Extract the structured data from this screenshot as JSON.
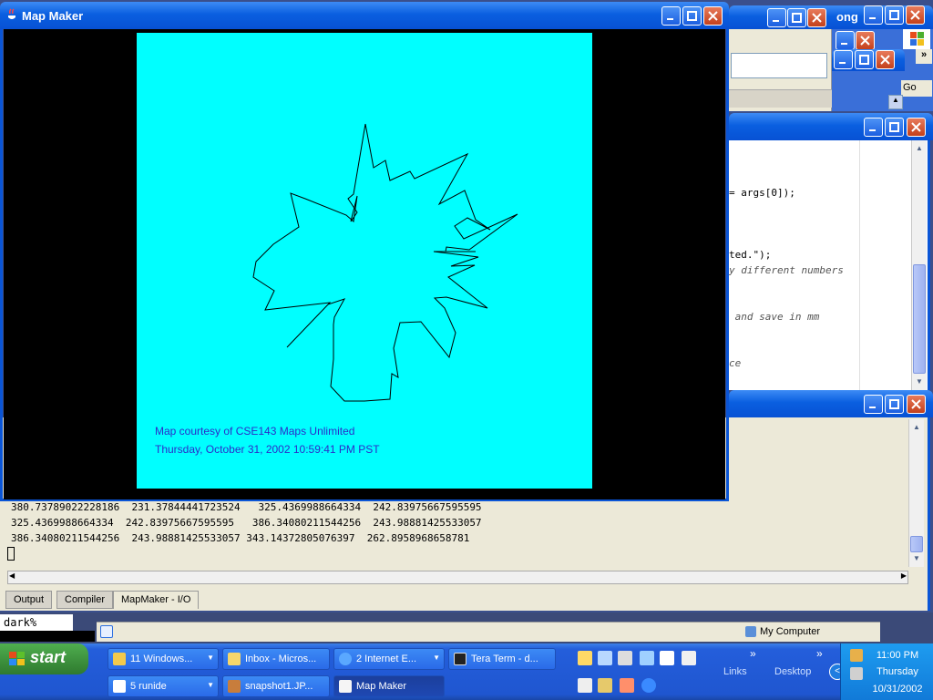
{
  "mapmaker": {
    "title": "Map Maker",
    "credit": "Map courtesy of CSE143 Maps Unlimited",
    "timestamp": "Thursday, October 31, 2002 10:59:41 PM PST",
    "map_bg": "#00ffff"
  },
  "background_windows": {
    "partial_title": "ong",
    "addr_go": "Go",
    "code_lines": [
      {
        "text": "= args[0]);",
        "style": "code"
      },
      {
        "text": "ted.\");",
        "style": "code"
      },
      {
        "text": "y different numbers",
        "style": "comment"
      },
      {
        "text": " and save in mm",
        "style": "comment"
      },
      {
        "text": "ce",
        "style": "comment"
      }
    ]
  },
  "output": {
    "lines": [
      "380.73789022228186  231.37844441723524   325.4369988664334  242.83975667595595",
      "325.4369988664334  242.83975667595595   386.34080211544256  243.98881425533057",
      "386.34080211544256  243.98881425533057 343.14372805076397  262.8958968658781"
    ],
    "tabs": [
      "Output",
      "Compiler",
      "MapMaker - I/O"
    ]
  },
  "console": {
    "prompt": "dark%"
  },
  "statusbar": {
    "zone": "My Computer"
  },
  "taskbar": {
    "start_label": "start",
    "row1": [
      {
        "label": "11 Windows...",
        "icon": "folder-icon",
        "dropdown": true
      },
      {
        "label": "Inbox - Micros...",
        "icon": "outlook-icon",
        "dropdown": false
      },
      {
        "label": "2 Internet E...",
        "icon": "ie-icon",
        "dropdown": true
      },
      {
        "label": "Tera Term - d...",
        "icon": "teraterm-icon",
        "dropdown": false
      }
    ],
    "row2": [
      {
        "label": "5 runide",
        "icon": "window-icon",
        "dropdown": true
      },
      {
        "label": "snapshot1.JP...",
        "icon": "image-icon",
        "dropdown": false
      },
      {
        "label": "Map Maker",
        "icon": "java-icon",
        "dropdown": false
      }
    ],
    "toolbars": [
      "Links",
      "Desktop"
    ],
    "clock": {
      "time": "11:00 PM",
      "day": "Thursday",
      "date": "10/31/2002"
    }
  }
}
